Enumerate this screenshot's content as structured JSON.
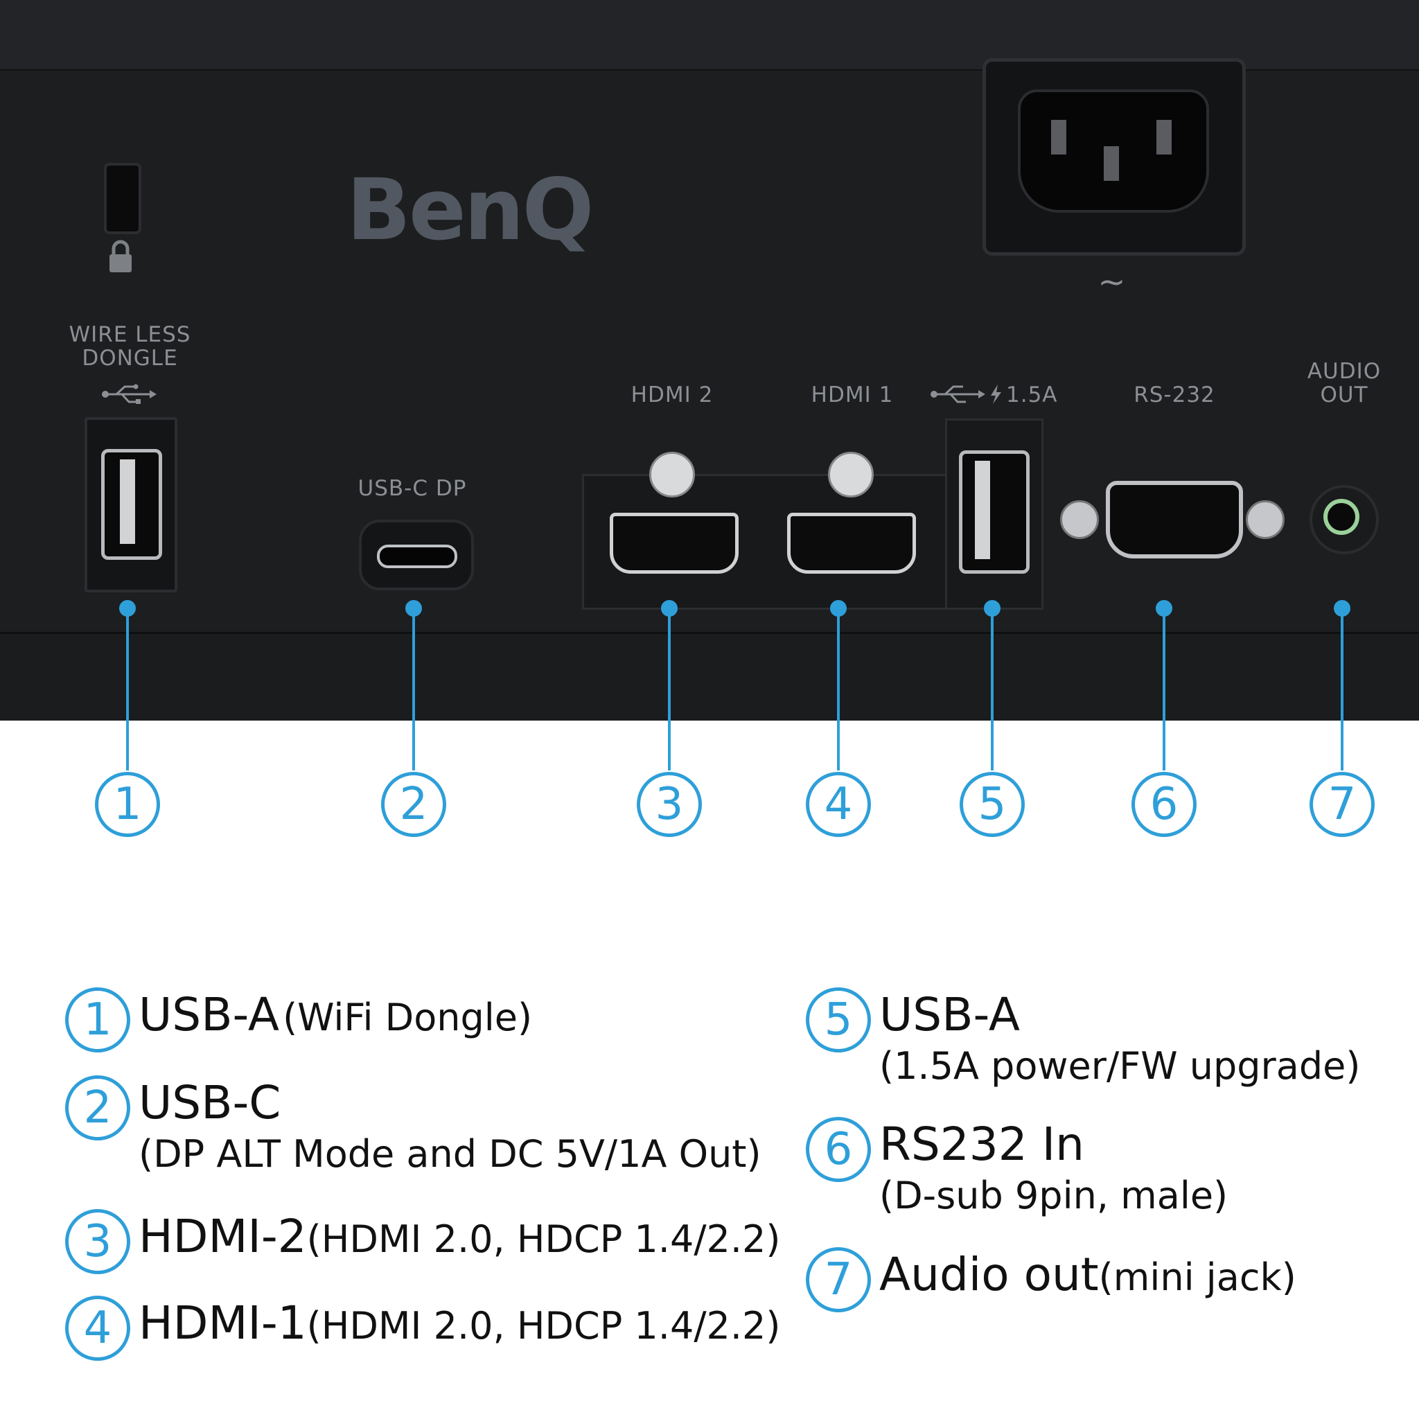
{
  "device": {
    "brand": "BenQ",
    "port_labels": {
      "wireless_dongle": "WIRE LESS\nDONGLE",
      "usbc_dp": "USB-C DP",
      "hdmi2": "HDMI 2",
      "hdmi1": "HDMI 1",
      "usb_power": "1.5A",
      "rs232": "RS-232",
      "audio_out": "AUDIO\nOUT"
    },
    "ac_symbol": "~"
  },
  "callout_numbers": [
    "1",
    "2",
    "3",
    "4",
    "5",
    "6",
    "7"
  ],
  "legend": [
    {
      "num": "1",
      "title": "USB-A",
      "sub": "(WiFi Dongle)",
      "inline": true
    },
    {
      "num": "2",
      "title": "USB-C",
      "sub": "(DP ALT Mode and DC 5V/1A Out)",
      "inline": false
    },
    {
      "num": "3",
      "title": "HDMI-2",
      "sub": "(HDMI 2.0, HDCP 1.4/2.2)",
      "inline": true
    },
    {
      "num": "4",
      "title": "HDMI-1",
      "sub": "(HDMI 2.0, HDCP 1.4/2.2)",
      "inline": true
    },
    {
      "num": "5",
      "title": "USB-A",
      "sub": "(1.5A power/FW upgrade)",
      "inline": false
    },
    {
      "num": "6",
      "title": "RS232 In",
      "sub": "(D-sub 9pin, male)",
      "inline": false
    },
    {
      "num": "7",
      "title": "Audio out",
      "sub": "(mini jack)",
      "inline": true
    }
  ],
  "colors": {
    "accent": "#2e9fd9",
    "panel": "#1d1e20",
    "label": "#8c8f94",
    "brand": "#515861"
  }
}
